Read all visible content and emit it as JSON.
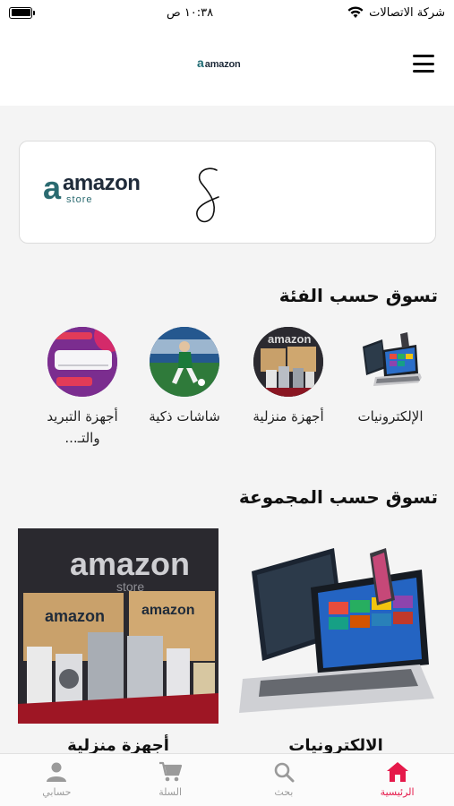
{
  "status_bar": {
    "carrier": "شركة الاتصالات",
    "time": "١٠:٣٨ ص"
  },
  "header": {
    "logo_mark": "a",
    "logo_word": "amazon"
  },
  "banner": {
    "logo_mark": "a",
    "logo_word": "amazon",
    "logo_sub": "store"
  },
  "sections": {
    "category_title": "تسوق حسب الفئة",
    "group_title": "تسوق حسب المجموعة"
  },
  "categories": [
    {
      "label": "الإلكترونيات"
    },
    {
      "label": "أجهزة منزلية"
    },
    {
      "label": "شاشات ذكية"
    },
    {
      "label": "أجهزة التبريد والتـ..."
    }
  ],
  "groups": [
    {
      "label": "الالكترونيات"
    },
    {
      "label": "أجهزة منزلية"
    }
  ],
  "bottom_nav": [
    {
      "label": "الرئيسية",
      "icon": "home-icon",
      "active": true
    },
    {
      "label": "بحث",
      "icon": "search-icon",
      "active": false
    },
    {
      "label": "السلة",
      "icon": "cart-icon",
      "active": false
    },
    {
      "label": "حسابي",
      "icon": "user-icon",
      "active": false
    }
  ],
  "colors": {
    "accent": "#e5194a",
    "brand_teal": "#2a6a70",
    "brand_dark": "#1f2b3a",
    "nav_inactive": "#9a9a9a"
  }
}
